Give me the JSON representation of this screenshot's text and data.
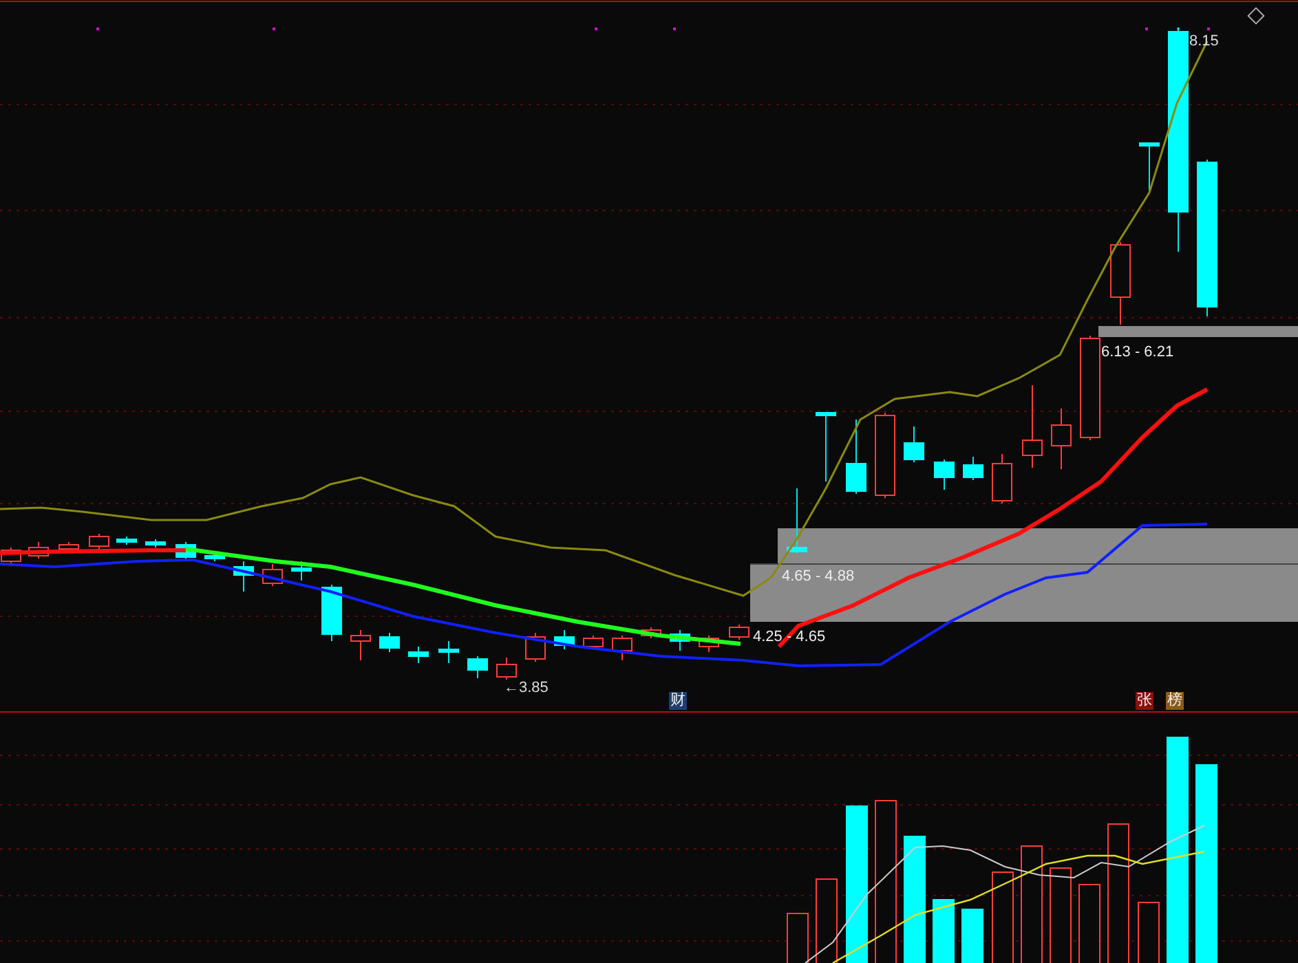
{
  "price_chart": {
    "high_label": "8.15",
    "low_label": "←3.85",
    "zones": [
      {
        "label": "6.13 - 6.21"
      },
      {
        "label": "4.65 - 4.88"
      },
      {
        "label": "4.25 - 4.65"
      }
    ]
  },
  "event_markers": [
    {
      "text": "财",
      "color": "#1c3f6e"
    },
    {
      "text": "张",
      "color": "#8b1010"
    },
    {
      "text": "榜",
      "color": "#8b5a1a"
    }
  ]
}
